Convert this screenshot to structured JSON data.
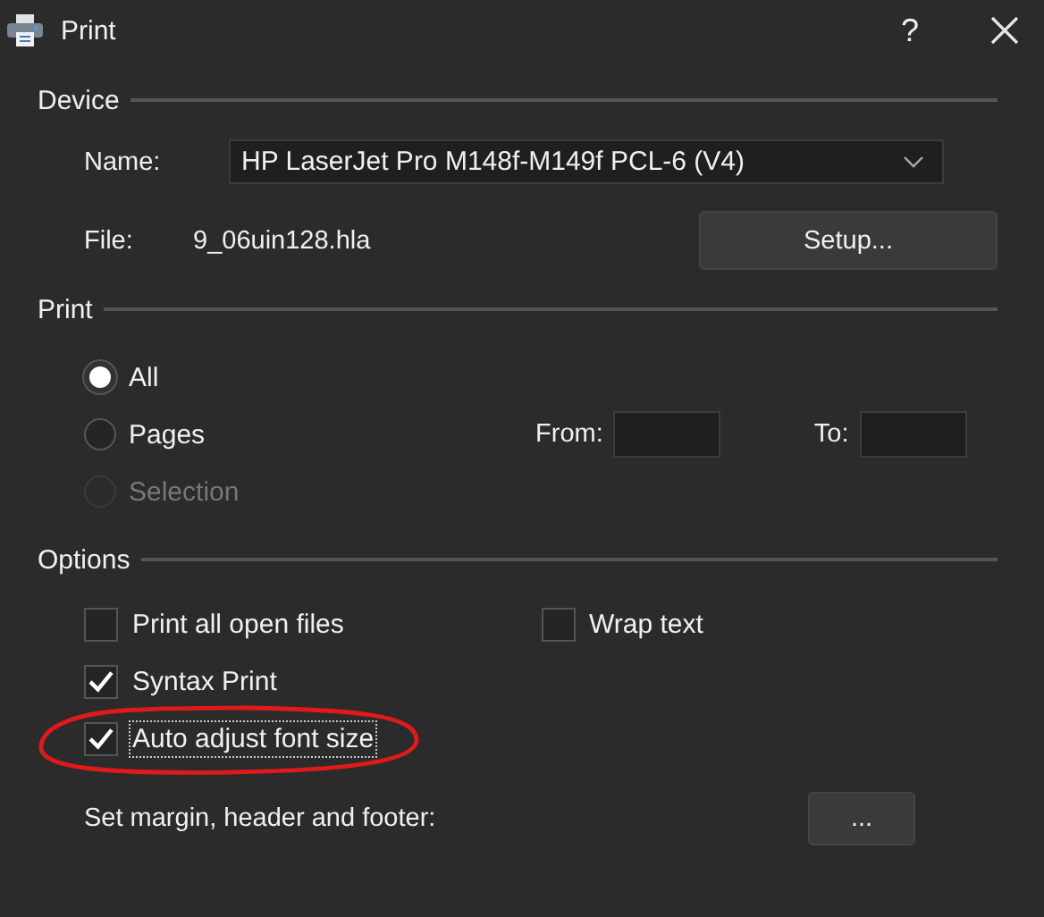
{
  "window": {
    "title": "Print",
    "help": "?"
  },
  "device": {
    "heading": "Device",
    "name_label": "Name:",
    "printer": "HP LaserJet Pro M148f-M149f PCL-6 (V4)",
    "file_label": "File:",
    "file": "9_06uin128.hla",
    "setup_button": "Setup..."
  },
  "print": {
    "heading": "Print",
    "ranges": [
      {
        "label": "All",
        "selected": true,
        "disabled": false
      },
      {
        "label": "Pages",
        "selected": false,
        "disabled": false
      },
      {
        "label": "Selection",
        "selected": false,
        "disabled": true
      }
    ],
    "from_label": "From:",
    "to_label": "To:"
  },
  "options": {
    "heading": "Options",
    "rows": [
      [
        {
          "label": "Print all open files",
          "checked": false,
          "focused": false,
          "circled": false
        },
        {
          "label": "Wrap text",
          "checked": false,
          "focused": false,
          "circled": false
        }
      ],
      [
        {
          "label": "Syntax Print",
          "checked": true,
          "focused": false,
          "circled": false
        }
      ],
      [
        {
          "label": "Auto adjust font size",
          "checked": true,
          "focused": true,
          "circled": true
        }
      ]
    ],
    "margin_label": "Set margin, header and footer:",
    "margin_button": "..."
  }
}
